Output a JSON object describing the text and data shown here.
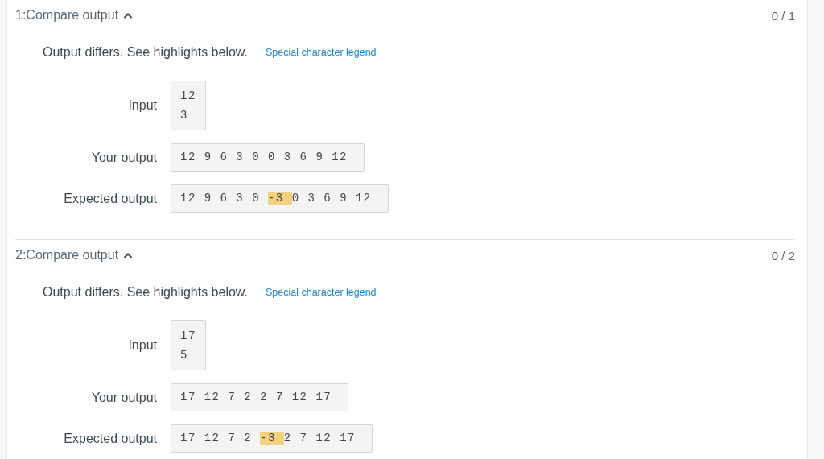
{
  "tests": [
    {
      "title": "1:Compare output",
      "expanded": true,
      "score": "0 / 1",
      "message": "Output differs. See highlights below.",
      "legend_link": "Special character legend",
      "rows": [
        {
          "kind": "input",
          "label": "Input",
          "lines": [
            "12",
            "3"
          ]
        },
        {
          "kind": "output",
          "label": "Your output",
          "tokens": [
            {
              "text": "12",
              "highlighted": false
            },
            {
              "text": "9",
              "highlighted": false
            },
            {
              "text": "6",
              "highlighted": false
            },
            {
              "text": "3",
              "highlighted": false
            },
            {
              "text": "0",
              "highlighted": false
            },
            {
              "text": "0",
              "highlighted": false
            },
            {
              "text": "3",
              "highlighted": false
            },
            {
              "text": "6",
              "highlighted": false
            },
            {
              "text": "9",
              "highlighted": false
            },
            {
              "text": "12",
              "highlighted": false
            }
          ]
        },
        {
          "kind": "output",
          "label": "Expected output",
          "tokens": [
            {
              "text": "12",
              "highlighted": false
            },
            {
              "text": "9",
              "highlighted": false
            },
            {
              "text": "6",
              "highlighted": false
            },
            {
              "text": "3",
              "highlighted": false
            },
            {
              "text": "0",
              "highlighted": false
            },
            {
              "text": "-3",
              "highlighted": true
            },
            {
              "text": "0",
              "highlighted": false
            },
            {
              "text": "3",
              "highlighted": false
            },
            {
              "text": "6",
              "highlighted": false
            },
            {
              "text": "9",
              "highlighted": false
            },
            {
              "text": "12",
              "highlighted": false
            }
          ]
        }
      ]
    },
    {
      "title": "2:Compare output",
      "expanded": true,
      "score": "0 / 2",
      "message": "Output differs. See highlights below.",
      "legend_link": "Special character legend",
      "rows": [
        {
          "kind": "input",
          "label": "Input",
          "lines": [
            "17",
            "5"
          ]
        },
        {
          "kind": "output",
          "label": "Your output",
          "tokens": [
            {
              "text": "17",
              "highlighted": false
            },
            {
              "text": "12",
              "highlighted": false
            },
            {
              "text": "7",
              "highlighted": false
            },
            {
              "text": "2",
              "highlighted": false
            },
            {
              "text": "2",
              "highlighted": false
            },
            {
              "text": "7",
              "highlighted": false
            },
            {
              "text": "12",
              "highlighted": false
            },
            {
              "text": "17",
              "highlighted": false
            }
          ]
        },
        {
          "kind": "output",
          "label": "Expected output",
          "tokens": [
            {
              "text": "17",
              "highlighted": false
            },
            {
              "text": "12",
              "highlighted": false
            },
            {
              "text": "7",
              "highlighted": false
            },
            {
              "text": "2",
              "highlighted": false
            },
            {
              "text": "-3",
              "highlighted": true
            },
            {
              "text": "2",
              "highlighted": false
            },
            {
              "text": "7",
              "highlighted": false
            },
            {
              "text": "12",
              "highlighted": false
            },
            {
              "text": "17",
              "highlighted": false
            }
          ]
        }
      ]
    }
  ]
}
